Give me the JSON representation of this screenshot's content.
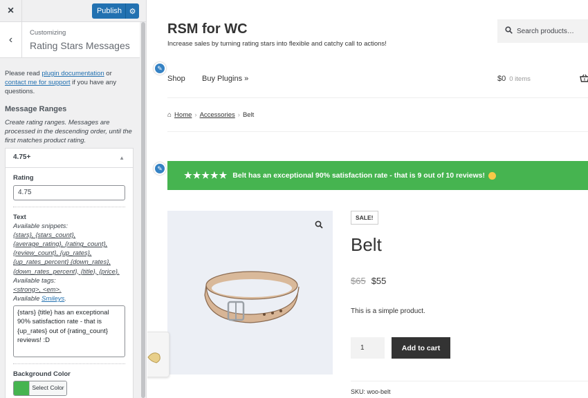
{
  "sidebar": {
    "close_icon": "×",
    "publish_label": "Publish",
    "section_small": "Customizing",
    "section_title": "Rating Stars Messages",
    "intro_pre": "Please read ",
    "link_docs": "plugin documentation",
    "intro_mid": " or ",
    "link_support": "contact me for support",
    "intro_post": " if you have any questions.",
    "ranges_title": "Message Ranges",
    "ranges_desc": "Create rating ranges. Messages are processed in the descending order, until the first matches product rating.",
    "range": {
      "header": "4.75+",
      "rating_label": "Rating",
      "rating_value": "4.75",
      "text_label": "Text",
      "snippets_label": "Available snippets:",
      "snippets": "{stars}, {stars_count}, {average_rating}, {rating_count}, {review_count}, {up_rates}, {up_rates_percent} {down_rates}, {down_rates_percent}, {title}, {price}.",
      "tags_label": "Available tags:",
      "tags": "<strong>, <em>.",
      "smileys_pre": "Available ",
      "smileys_link": "Smileys",
      "smileys_post": ".",
      "text_value": "{stars} {title} has an exceptional 90% satisfaction rate - that is {up_rates} out of {rating_count} reviews! :D",
      "bg_label": "Background Color",
      "bg_color": "#46b450",
      "select_color": "Select Color"
    }
  },
  "preview": {
    "site_title": "RSM for WC",
    "tagline": "Increase sales by turning rating stars into flexible and catchy call to actions!",
    "search_placeholder": "Search products…",
    "nav": [
      "Shop",
      "Buy Plugins »"
    ],
    "cart_amount": "$0",
    "cart_items": "0 items",
    "breadcrumb": [
      "Home",
      "Accessories",
      "Belt"
    ],
    "banner_stars": "★★★★★",
    "banner_text": "Belt has an exceptional 90% satisfaction rate - that is 9 out of 10 reviews!",
    "banner_color": "#46b450",
    "sale_badge": "SALE!",
    "product_title": "Belt",
    "old_price": "$65",
    "new_price": "$55",
    "short_desc": "This is a simple product.",
    "qty": "1",
    "add_to_cart": "Add to cart",
    "sku": "SKU: woo-belt"
  }
}
